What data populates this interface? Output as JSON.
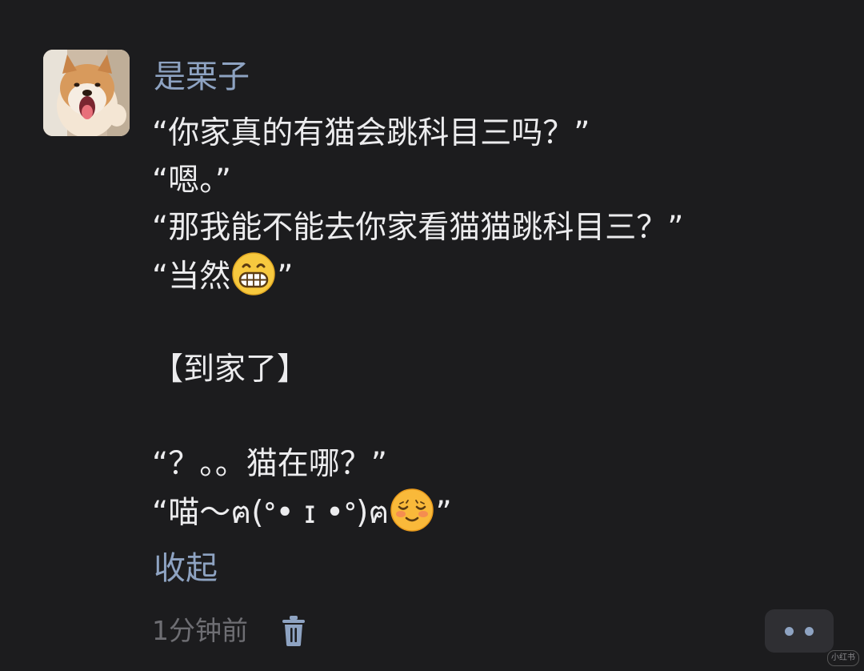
{
  "comment": {
    "username": "是栗子",
    "lines": [
      "“你家真的有猫会跳科目三吗？”",
      "“嗯。”",
      "“那我能不能去你家看猫猫跳科目三？”",
      "“当然",
      "”",
      "【到家了】",
      "“？。。猫在哪？”",
      "“喵～ฅ(ᐤ• ɪ •ᐤ)ฅ",
      "”"
    ],
    "collapse_label": "收起",
    "timestamp": "1分钟前"
  },
  "icons": {
    "avatar": "shiba-dog-avatar",
    "emoji_grin": "grinning-face-emoji",
    "emoji_blush": "relieved-smiling-face-emoji",
    "delete": "trash-icon",
    "more": "more-dots-icon"
  },
  "colors": {
    "background": "#1c1c1e",
    "accent": "#8ea3c2",
    "text": "#ececee",
    "muted": "#6e6e73"
  },
  "watermark": "小红书"
}
